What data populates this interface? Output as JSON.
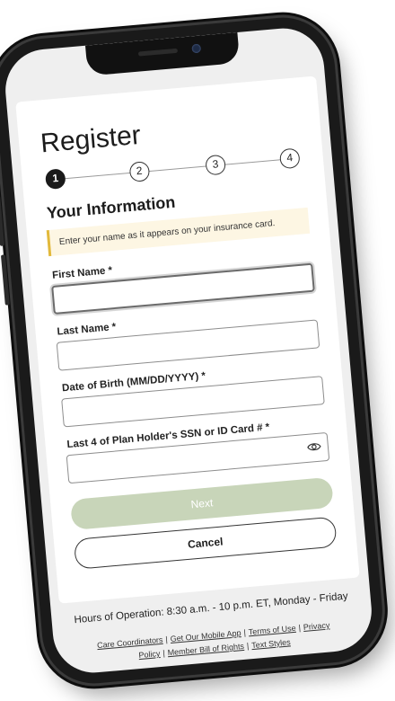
{
  "register": {
    "title": "Register",
    "steps": [
      "1",
      "2",
      "3",
      "4"
    ],
    "section_title": "Your Information",
    "notice": "Enter your name as it appears on your insurance card."
  },
  "form": {
    "first_name_label": "First Name *",
    "first_name_value": "",
    "last_name_label": "Last Name *",
    "last_name_value": "",
    "dob_label": "Date of Birth (MM/DD/YYYY) *",
    "dob_value": "",
    "ssn_label": "Last 4 of Plan Holder's SSN or ID Card # *",
    "ssn_value": ""
  },
  "buttons": {
    "next": "Next",
    "cancel": "Cancel"
  },
  "footer": {
    "hours": "Hours of Operation: 8:30 a.m. - 10 p.m. ET, Monday - Friday",
    "links": [
      "Care Coordinators",
      "Get Our Mobile App",
      "Terms of Use",
      "Privacy Policy",
      "Member Bill of Rights",
      "Text Styles"
    ]
  },
  "colors": {
    "next_button_bg": "#c8d5b9",
    "notice_bg": "#fdf6e3",
    "notice_accent": "#e2b93b"
  }
}
